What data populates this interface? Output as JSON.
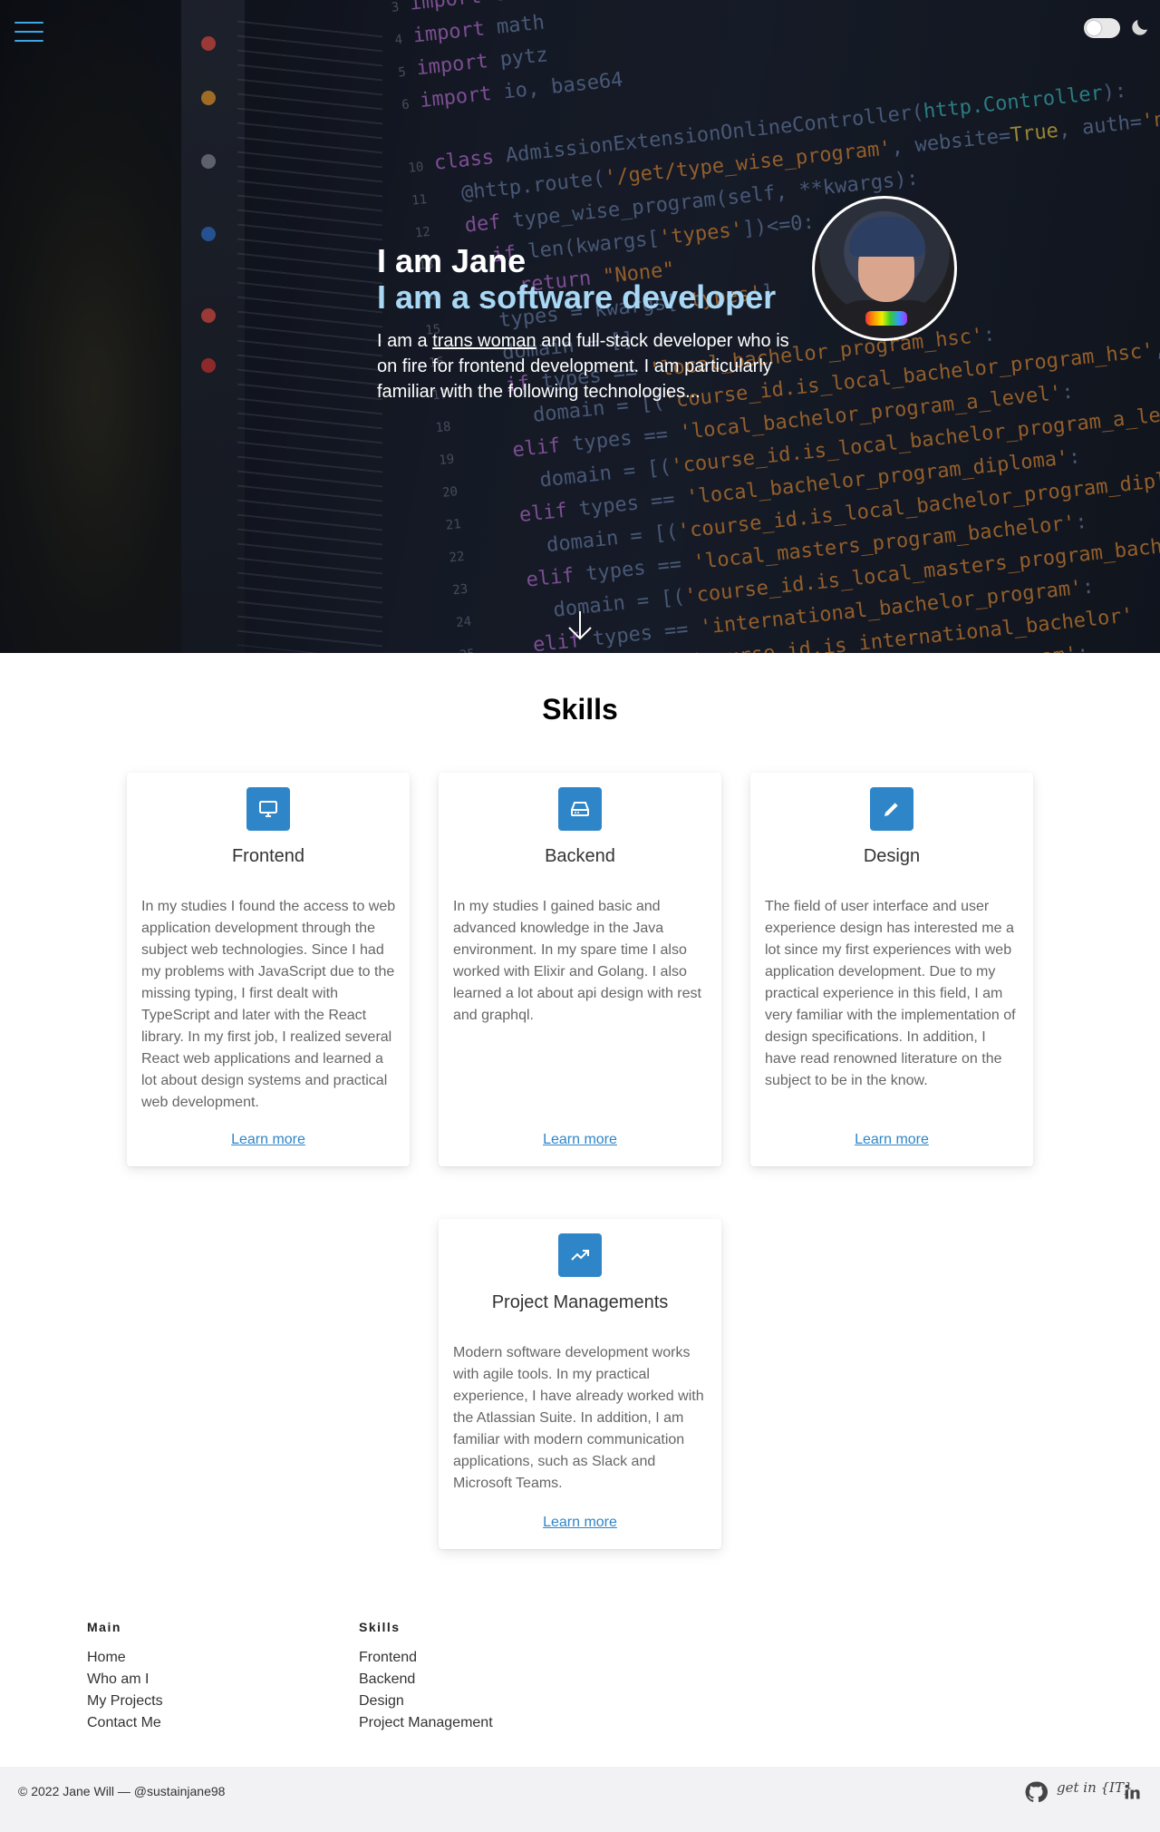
{
  "hero": {
    "title": "I am Jane",
    "subtitle": "I am a software developer",
    "intro_before": "I am a ",
    "intro_link": "trans woman",
    "intro_after": " and full-stack developer who is on fire for frontend development. I am particularly familiar with the following technologies..."
  },
  "skills": {
    "title": "Skills",
    "cards": [
      {
        "icon": "monitor-icon",
        "title": "Frontend",
        "text": "In my studies I found the access to web application development through the subject web technologies. Since I had my problems with JavaScript due to the missing typing, I first dealt with TypeScript and later with the React library. In my first job, I realized several React web applications and learned a lot about design systems and practical web development.",
        "link": "Learn more"
      },
      {
        "icon": "server-icon",
        "title": "Backend",
        "text": "In my studies I gained basic and advanced knowledge in the Java environment. In my spare time I also worked with Elixir and Golang. I also learned a lot about api design with rest and graphql.",
        "link": "Learn more"
      },
      {
        "icon": "pencil-icon",
        "title": "Design",
        "text": "The field of user interface and user experience design has interested me a lot since my first experiences with web application development. Due to my practical experience in this field, I am very familiar with the implementation of design specifications. In addition, I have read renowned literature on the subject to be in the know.",
        "link": "Learn more"
      },
      {
        "icon": "trending-up-icon",
        "title": "Project Managements",
        "text": "Modern software development works with agile tools. In my practical experience, I have already worked with the Atlassian Suite. In addition, I am familiar with modern communication applications, such as Slack and Microsoft Teams.",
        "link": "Learn more"
      }
    ]
  },
  "footer": {
    "main": {
      "heading": "Main",
      "links": [
        "Home",
        "Who am I",
        "My Projects",
        "Contact Me"
      ]
    },
    "skills": {
      "heading": "Skills",
      "links": [
        "Frontend",
        "Backend",
        "Design",
        "Project Management"
      ]
    },
    "copyright": "© 2022 Jane Will — @sustainjane98",
    "getin_logo": "get in {IT}",
    "social_icons": [
      "github-icon",
      "getin-it-logo",
      "linkedin-icon"
    ]
  },
  "colors": {
    "accent": "#2e86c9",
    "subtitle": "#a8d8f5",
    "menu": "#3fa6e6"
  }
}
